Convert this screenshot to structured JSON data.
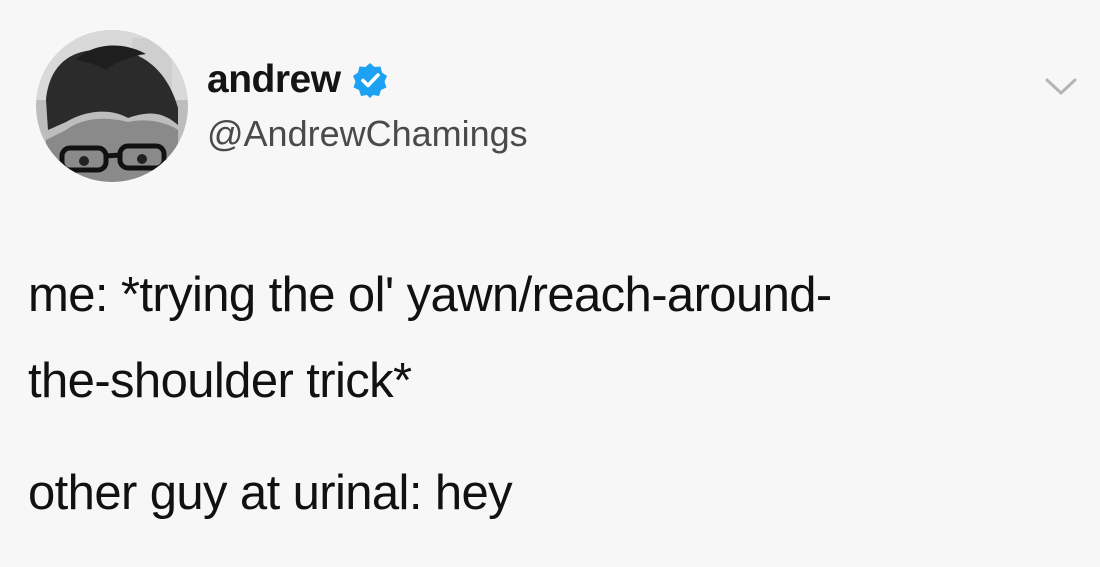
{
  "author": {
    "display_name": "andrew",
    "handle": "@AndrewChamings",
    "verified": true,
    "avatar_icon": "avatar-photo",
    "verified_icon": "verified-badge-icon",
    "accent_color": "#1da1f2"
  },
  "menu": {
    "icon": "chevron-down-icon"
  },
  "tweet": {
    "lines": [
      "me: *trying the ol' yawn/reach-around-",
      "the-shoulder trick*",
      "other guy at urinal: hey"
    ]
  }
}
